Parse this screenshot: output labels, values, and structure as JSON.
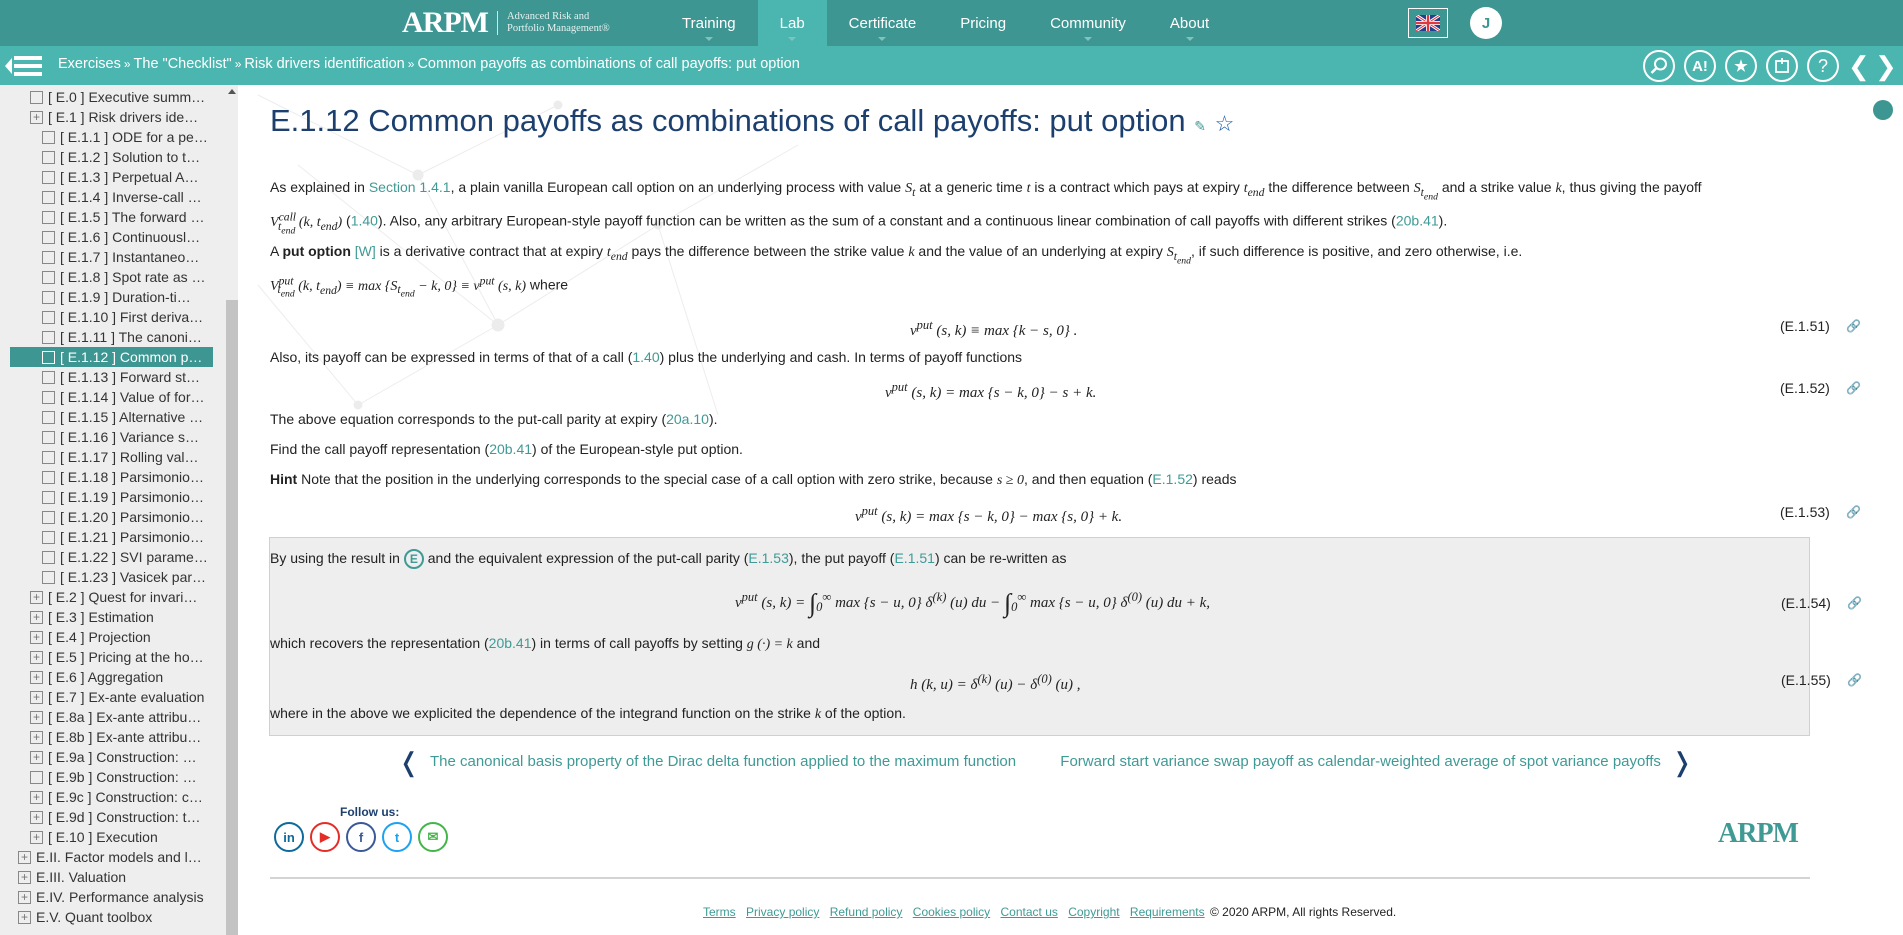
{
  "header": {
    "logo_mark": "ARPM",
    "logo_tag_line1": "Advanced Risk and",
    "logo_tag_line2": "Portfolio Management®",
    "nav": [
      {
        "label": "Training",
        "has_caret": true
      },
      {
        "label": "Lab",
        "has_caret": true,
        "active": true
      },
      {
        "label": "Certificate",
        "has_caret": true
      },
      {
        "label": "Pricing",
        "has_caret": false
      },
      {
        "label": "Community",
        "has_caret": true
      },
      {
        "label": "About",
        "has_caret": true
      }
    ],
    "language_flag": "🇬🇧",
    "avatar_initial": "J"
  },
  "subbar": {
    "breadcrumb": [
      "Exercises",
      "The \"Checklist\"",
      "Risk drivers identification",
      "Common payoffs as combinations of call payoffs: put option"
    ],
    "breadcrumb_sep": "»",
    "tools": [
      "search-icon",
      "text-size-icon",
      "favorite-star-icon",
      "notes-icon",
      "help-icon"
    ],
    "tool_glyphs": [
      "⌕",
      "A!",
      "★",
      "✎",
      "?"
    ],
    "prev_glyph": "❮",
    "next_glyph": "❯"
  },
  "sidebar": {
    "items": [
      {
        "label": "[ E.0 ] Executive summ…",
        "level": 1,
        "expandable": false
      },
      {
        "label": "[ E.1 ] Risk drivers ide…",
        "level": 1,
        "expandable": true
      },
      {
        "label": "[ E.1.1 ] ODE for a pe…",
        "level": 2
      },
      {
        "label": "[ E.1.2 ] Solution to t…",
        "level": 2
      },
      {
        "label": "[ E.1.3 ] Perpetual A…",
        "level": 2
      },
      {
        "label": "[ E.1.4 ] Inverse-call …",
        "level": 2
      },
      {
        "label": "[ E.1.5 ] The forward …",
        "level": 2
      },
      {
        "label": "[ E.1.6 ] Continuousl…",
        "level": 2
      },
      {
        "label": "[ E.1.7 ] Instantaneo…",
        "level": 2
      },
      {
        "label": "[ E.1.8 ] Spot rate as …",
        "level": 2
      },
      {
        "label": "[ E.1.9 ] Duration-ti…",
        "level": 2
      },
      {
        "label": "[ E.1.10 ] First deriva…",
        "level": 2
      },
      {
        "label": "[ E.1.11 ] The canoni…",
        "level": 2
      },
      {
        "label": "[ E.1.12 ] Common p…",
        "level": 2,
        "active": true
      },
      {
        "label": "[ E.1.13 ] Forward st…",
        "level": 2
      },
      {
        "label": "[ E.1.14 ] Value of for…",
        "level": 2
      },
      {
        "label": "[ E.1.15 ] Alternative …",
        "level": 2
      },
      {
        "label": "[ E.1.16 ] Variance s…",
        "level": 2
      },
      {
        "label": "[ E.1.17 ] Rolling val…",
        "level": 2
      },
      {
        "label": "[ E.1.18 ] Parsimonio…",
        "level": 2
      },
      {
        "label": "[ E.1.19 ] Parsimonio…",
        "level": 2
      },
      {
        "label": "[ E.1.20 ] Parsimonio…",
        "level": 2
      },
      {
        "label": "[ E.1.21 ] Parsimonio…",
        "level": 2
      },
      {
        "label": "[ E.1.22 ] SVI parame…",
        "level": 2
      },
      {
        "label": "[ E.1.23 ] Vasicek par…",
        "level": 2
      },
      {
        "label": "[ E.2 ] Quest for invari…",
        "level": 1,
        "expandable": true
      },
      {
        "label": "[ E.3 ] Estimation",
        "level": 1,
        "expandable": true
      },
      {
        "label": "[ E.4 ] Projection",
        "level": 1,
        "expandable": true
      },
      {
        "label": "[ E.5 ] Pricing at the ho…",
        "level": 1,
        "expandable": true
      },
      {
        "label": "[ E.6 ] Aggregation",
        "level": 1,
        "expandable": true
      },
      {
        "label": "[ E.7 ] Ex-ante evaluation",
        "level": 1,
        "expandable": true
      },
      {
        "label": "[ E.8a ] Ex-ante attribu…",
        "level": 1,
        "expandable": true
      },
      {
        "label": "[ E.8b ] Ex-ante attribu…",
        "level": 1,
        "expandable": true
      },
      {
        "label": "[ E.9a ] Construction: …",
        "level": 1,
        "expandable": true
      },
      {
        "label": "[ E.9b ] Construction: …",
        "level": 1,
        "expandable": false
      },
      {
        "label": "[ E.9c ] Construction: c…",
        "level": 1,
        "expandable": true
      },
      {
        "label": "[ E.9d ] Construction: t…",
        "level": 1,
        "expandable": true
      },
      {
        "label": "[ E.10 ] Execution",
        "level": 1,
        "expandable": true
      },
      {
        "label": "E.II. Factor models and l…",
        "level": 0,
        "expandable": true
      },
      {
        "label": "E.III. Valuation",
        "level": 0,
        "expandable": true
      },
      {
        "label": "E.IV. Performance analysis",
        "level": 0,
        "expandable": true
      },
      {
        "label": "E.V. Quant toolbox",
        "level": 0,
        "expandable": true
      }
    ]
  },
  "page": {
    "title": "E.1.12 Common payoffs as combinations of call payoffs: put option",
    "title_link_glyph": "✎",
    "title_star_glyph": "☆",
    "p1_a": "As explained in ",
    "p1_link": "Section 1.4.1",
    "p1_b": ", a plain vanilla European call option on an underlying process with value ",
    "p1_St": "S",
    "p1_c": " at a generic time ",
    "p1_t": "t",
    "p1_d": " is a contract which pays at expiry ",
    "p1_tend": "t",
    "p1_e": " the difference between ",
    "p1_f": " and a strike value ",
    "p1_k": "k",
    "p1_g": ", thus giving the payoff",
    "p2_V": "V",
    "p2_args": "(k, t",
    "p2_link": "1.40",
    "p2_a": ". Also, any arbitrary European-style payoff function can be written as the sum of a constant and a continuous linear combination of call payoffs with different strikes (",
    "p2_link2": "20b.41",
    "p2_b": ").",
    "p3_a": "A ",
    "p3_bold": "put option",
    "p3_w": "[W]",
    "p3_b": " is a derivative contract that at expiry ",
    "p3_c": " pays the difference between the strike value ",
    "p3_d": " and the value of an underlying at expiry ",
    "p3_e": ", if such difference is positive, and zero otherwise, i.e.",
    "p4_formula": "V^put_tend (k, t_end) ≡ max {S_tend − k, 0} ≡ v^put (s, k)",
    "p4_where": " where",
    "eq51": "v^put (s, k) ≡ max {k − s, 0} .",
    "eq51_num": "(E.1.51)",
    "p5_a": "Also, its payoff can be expressed in terms of that of a call (",
    "p5_link": "1.40",
    "p5_b": ") plus the underlying and cash. In terms of payoff functions",
    "eq52": "v^put (s, k) = max {s − k, 0} − s + k.",
    "eq52_num": "(E.1.52)",
    "p6_a": "The above equation corresponds to the put-call parity at expiry (",
    "p6_link": "20a.10",
    "p6_b": ").",
    "p7_a": "Find the call payoff representation (",
    "p7_link": "20b.41",
    "p7_b": ") of the European-style put option.",
    "hint_label": "Hint",
    "hint_a": " Note that the position in the underlying corresponds to the special case of a call option with zero strike, because ",
    "hint_math": "s ≥ 0",
    "hint_b": ", and then equation (",
    "hint_link": "E.1.52",
    "hint_c": ") reads",
    "eq53": "v^put (s, k) = max {s − k, 0} − max {s, 0} + k.",
    "eq53_num": "(E.1.53)",
    "link_glyph": "🔗"
  },
  "solution": {
    "s1_a": "By using the result in ",
    "s1_badge": "E",
    "s1_b": " and the equivalent expression of the put-call parity (",
    "s1_link1": "E.1.53",
    "s1_c": "), the put payoff (",
    "s1_link2": "E.1.51",
    "s1_d": ") can be re-written as",
    "eq54": "v^put (s, k) = ∫₀^∞ max {s − u, 0} δ^(k) (u) du − ∫₀^∞ max {s − u, 0} δ^(0) (u) du + k,",
    "eq54_num": "(E.1.54)",
    "s2_a": "which recovers the representation (",
    "s2_link": "20b.41",
    "s2_b": ") in terms of call payoffs by setting ",
    "s2_math": "g (·) = k",
    "s2_c": " and",
    "eq55": "h (k, u) = δ^(k) (u) − δ^(0) (u) ,",
    "eq55_num": "(E.1.55)",
    "s3_a": "where in the above we explicited the dependence of the integrand function on the strike ",
    "s3_k": "k",
    "s3_b": " of the option."
  },
  "pager": {
    "prev": "The canonical basis property of the Dirac delta function applied to the maximum function",
    "next": "Forward start variance swap payoff as calendar-weighted average of spot variance payoffs",
    "prev_glyph": "❬",
    "next_glyph": "❭"
  },
  "footer": {
    "follow_label": "Follow us:",
    "socials": [
      {
        "name": "linkedin",
        "glyph": "in",
        "color": "#0e6a9c"
      },
      {
        "name": "youtube",
        "glyph": "▶",
        "color": "#e52d27"
      },
      {
        "name": "facebook",
        "glyph": "f",
        "color": "#3b5998"
      },
      {
        "name": "twitter",
        "glyph": "t",
        "color": "#1da1f2"
      },
      {
        "name": "wechat",
        "glyph": "✉",
        "color": "#44b549"
      }
    ],
    "logo": "ARPM",
    "links": [
      "Terms",
      "Privacy policy",
      "Refund policy",
      "Cookies policy",
      "Contact us",
      "Copyright",
      "Requirements"
    ],
    "copyright": "© 2020 ARPM, All rights Reserved."
  }
}
